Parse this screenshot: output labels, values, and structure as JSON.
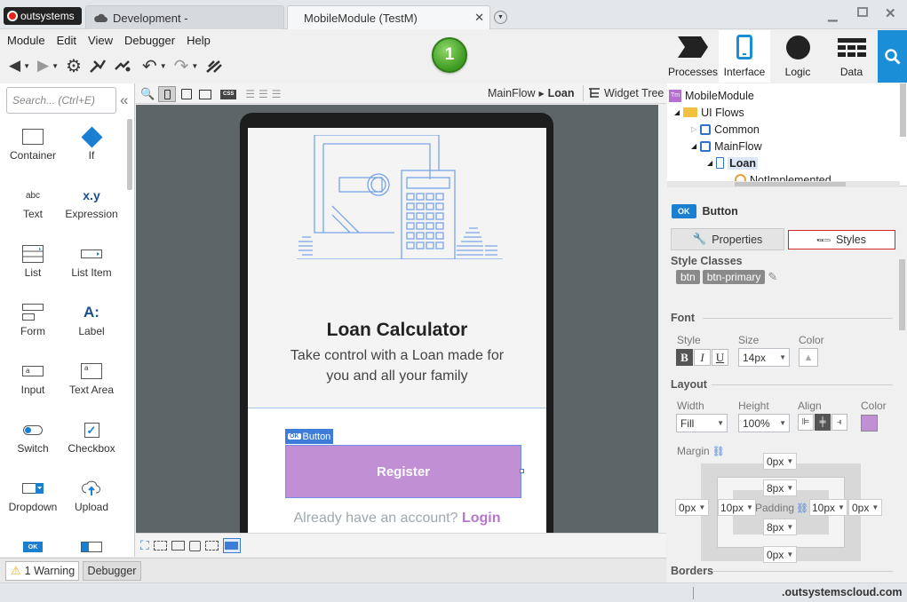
{
  "titlebar": {
    "brand": "outsystems",
    "tabs": [
      "Development -",
      "MobileModule (TestM)"
    ],
    "window_controls": [
      "minimize",
      "maximize",
      "close"
    ]
  },
  "menu": [
    "Module",
    "Edit",
    "View",
    "Debugger",
    "Help"
  ],
  "publish_badge": "1",
  "nav": {
    "processes": "Processes",
    "interface": "Interface",
    "logic": "Logic",
    "data": "Data",
    "active": "Interface",
    "accent": "#1a8fd8"
  },
  "toolbox": {
    "search_placeholder": "Search... (Ctrl+E)",
    "collapse": "«",
    "items": [
      {
        "label": "Container",
        "icon": "container-icon"
      },
      {
        "label": "If",
        "icon": "if-icon"
      },
      {
        "label": "Text",
        "icon": "text-icon",
        "glyph": "abc"
      },
      {
        "label": "Expression",
        "icon": "expression-icon",
        "glyph": "x.y"
      },
      {
        "label": "List",
        "icon": "list-icon"
      },
      {
        "label": "List Item",
        "icon": "list-item-icon"
      },
      {
        "label": "Form",
        "icon": "form-icon"
      },
      {
        "label": "Label",
        "icon": "label-icon",
        "glyph": "A:"
      },
      {
        "label": "Input",
        "icon": "input-icon",
        "glyph": "a"
      },
      {
        "label": "Text Area",
        "icon": "text-area-icon",
        "glyph": "a"
      },
      {
        "label": "Switch",
        "icon": "switch-icon"
      },
      {
        "label": "Checkbox",
        "icon": "checkbox-icon"
      },
      {
        "label": "Dropdown",
        "icon": "dropdown-icon"
      },
      {
        "label": "Upload",
        "icon": "upload-icon"
      },
      {
        "label": "",
        "icon": "button-icon",
        "glyph": "OK"
      },
      {
        "label": "",
        "icon": "button-group-icon"
      }
    ]
  },
  "canvas": {
    "breadcrumb_flow": "MainFlow",
    "breadcrumb_screen": "Loan",
    "widget_tree": "Widget Tree",
    "css_label": "CSS",
    "screen": {
      "title": "Loan Calculator",
      "subtitle": "Take control with a Loan made for you and all your family",
      "button_badge_ok": "OK",
      "button_badge": "Button",
      "register": "Register",
      "already_text": "Already have an account?",
      "login": "Login"
    }
  },
  "tree": {
    "root": "MobileModule",
    "root_icon_text": "Tm",
    "items": [
      {
        "label": "UI Flows",
        "indent": 1
      },
      {
        "label": "Common",
        "indent": 2
      },
      {
        "label": "MainFlow",
        "indent": 2
      },
      {
        "label": "Loan",
        "indent": 3,
        "bold": true
      },
      {
        "label": "NotImplemented",
        "indent": 4
      }
    ]
  },
  "properties": {
    "widget_badge": "OK",
    "widget_type": "Button",
    "tab_properties": "Properties",
    "tab_styles": "Styles",
    "style_classes_label": "Style Classes",
    "style_classes": [
      "btn",
      "btn-primary"
    ],
    "font_section": "Font",
    "style_label": "Style",
    "size_label": "Size",
    "color_label": "Color",
    "font_buttons": [
      "B",
      "I",
      "U"
    ],
    "font_size": "14px",
    "layout_section": "Layout",
    "width_label": "Width",
    "height_label": "Height",
    "align_label": "Align",
    "layout_color_label": "Color",
    "width": "Fill",
    "height": "100%",
    "bg_color": "#c190d4",
    "margin_label": "Margin",
    "padding_label": "Padding",
    "margin_top": "0px",
    "margin_left": "0px",
    "margin_right": "0px",
    "margin_bottom": "0px",
    "padding_top": "8px",
    "padding_left": "10px",
    "padding_right": "10px",
    "padding_bottom": "8px",
    "borders_section": "Borders"
  },
  "statusbar": {
    "warning": "1 Warning",
    "debugger": "Debugger",
    "server": ".outsystemscloud.com"
  }
}
